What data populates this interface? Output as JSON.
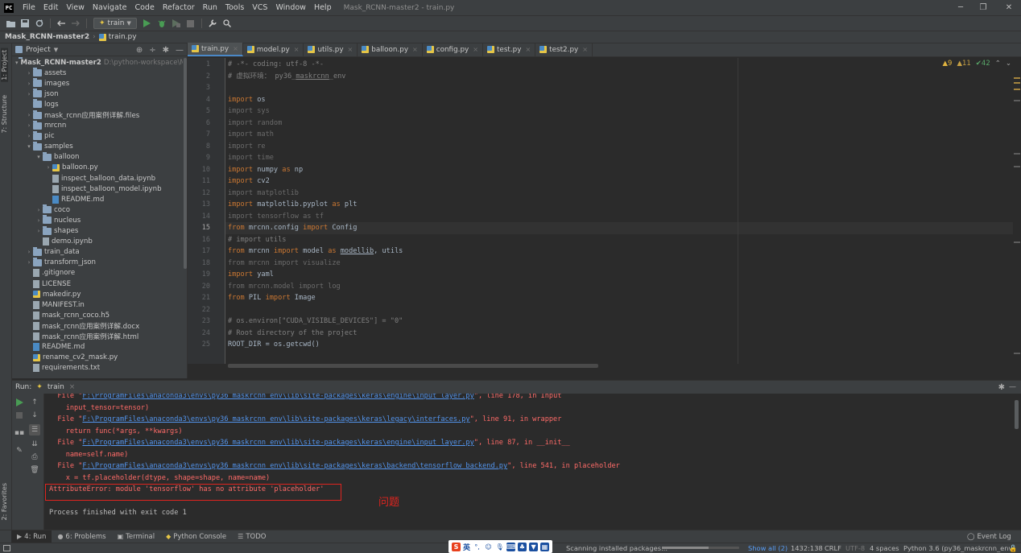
{
  "menubar": {
    "logo": "PC",
    "items": [
      "File",
      "Edit",
      "View",
      "Navigate",
      "Code",
      "Refactor",
      "Run",
      "Tools",
      "VCS",
      "Window",
      "Help"
    ],
    "window_title": "Mask_RCNN-master2 - train.py",
    "minimize": "─",
    "maximize": "❐",
    "close": "✕"
  },
  "toolbar": {
    "run_config": "train",
    "icons": [
      "open-folder-icon",
      "save-icon",
      "sync-icon",
      "back-icon",
      "forward-icon",
      "run-config-icon",
      "run-icon",
      "debug-icon",
      "coverage-icon",
      "stop-icon",
      "wrench-icon",
      "search-icon"
    ]
  },
  "navbar": {
    "project": "Mask_RCNN-master2",
    "file": "train.py"
  },
  "left_strip": {
    "project_label": "1: Project",
    "structure_label": "7: Structure",
    "favorites_label": "2: Favorites"
  },
  "project_panel": {
    "title": "Project",
    "tree": [
      {
        "label": "Mask_RCNN-master2",
        "path": "D:\\python-workspace\\Mas",
        "type": "folder",
        "depth": 0,
        "arrow": "▾",
        "bold": true
      },
      {
        "label": "assets",
        "type": "folder",
        "depth": 1,
        "arrow": "›"
      },
      {
        "label": "images",
        "type": "folder",
        "depth": 1,
        "arrow": "›"
      },
      {
        "label": "json",
        "type": "folder",
        "depth": 1,
        "arrow": "›"
      },
      {
        "label": "logs",
        "type": "folder",
        "depth": 1,
        "arrow": ""
      },
      {
        "label": "mask_rcnn应用案例详解.files",
        "type": "folder",
        "depth": 1,
        "arrow": "›"
      },
      {
        "label": "mrcnn",
        "type": "folder",
        "depth": 1,
        "arrow": "›"
      },
      {
        "label": "pic",
        "type": "folder",
        "depth": 1,
        "arrow": "›"
      },
      {
        "label": "samples",
        "type": "folder",
        "depth": 1,
        "arrow": "▾"
      },
      {
        "label": "balloon",
        "type": "folder",
        "depth": 2,
        "arrow": "▾"
      },
      {
        "label": "balloon.py",
        "type": "py",
        "depth": 3,
        "arrow": "›"
      },
      {
        "label": "inspect_balloon_data.ipynb",
        "type": "file",
        "depth": 3,
        "arrow": ""
      },
      {
        "label": "inspect_balloon_model.ipynb",
        "type": "file",
        "depth": 3,
        "arrow": ""
      },
      {
        "label": "README.md",
        "type": "md",
        "depth": 3,
        "arrow": ""
      },
      {
        "label": "coco",
        "type": "folder",
        "depth": 2,
        "arrow": "›"
      },
      {
        "label": "nucleus",
        "type": "folder",
        "depth": 2,
        "arrow": "›"
      },
      {
        "label": "shapes",
        "type": "folder",
        "depth": 2,
        "arrow": "›"
      },
      {
        "label": "demo.ipynb",
        "type": "file",
        "depth": 2,
        "arrow": ""
      },
      {
        "label": "train_data",
        "type": "folder",
        "depth": 1,
        "arrow": "›"
      },
      {
        "label": "transform_json",
        "type": "folder",
        "depth": 1,
        "arrow": "›"
      },
      {
        "label": ".gitignore",
        "type": "file",
        "depth": 1,
        "arrow": ""
      },
      {
        "label": "LICENSE",
        "type": "file",
        "depth": 1,
        "arrow": ""
      },
      {
        "label": "makedir.py",
        "type": "py",
        "depth": 1,
        "arrow": ""
      },
      {
        "label": "MANIFEST.in",
        "type": "file",
        "depth": 1,
        "arrow": ""
      },
      {
        "label": "mask_rcnn_coco.h5",
        "type": "file",
        "depth": 1,
        "arrow": ""
      },
      {
        "label": "mask_rcnn应用案例详解.docx",
        "type": "file",
        "depth": 1,
        "arrow": ""
      },
      {
        "label": "mask_rcnn应用案例详解.html",
        "type": "file",
        "depth": 1,
        "arrow": ""
      },
      {
        "label": "README.md",
        "type": "md",
        "depth": 1,
        "arrow": ""
      },
      {
        "label": "rename_cv2_mask.py",
        "type": "py",
        "depth": 1,
        "arrow": ""
      },
      {
        "label": "requirements.txt",
        "type": "file",
        "depth": 1,
        "arrow": ""
      }
    ]
  },
  "editor": {
    "tabs": [
      {
        "label": "train.py",
        "active": true
      },
      {
        "label": "model.py",
        "active": false
      },
      {
        "label": "utils.py",
        "active": false
      },
      {
        "label": "balloon.py",
        "active": false
      },
      {
        "label": "config.py",
        "active": false
      },
      {
        "label": "test.py",
        "active": false
      },
      {
        "label": "test2.py",
        "active": false
      }
    ],
    "tab_close": "×",
    "inspections": {
      "warnings": "▲9",
      "weak": "▲11",
      "ok": "✔42",
      "up": "⌃",
      "down": "⌄"
    },
    "current_line": 15,
    "lines": [
      {
        "n": 1,
        "parts": [
          [
            "cm",
            "# -*- coding: utf-8 -*-"
          ]
        ]
      },
      {
        "n": 2,
        "parts": [
          [
            "cm",
            "# 虚拟环境： py36_"
          ],
          [
            "cm ul",
            "maskrcnn"
          ],
          [
            "cm",
            "_env"
          ]
        ]
      },
      {
        "n": 3,
        "parts": []
      },
      {
        "n": 4,
        "parts": [
          [
            "kw",
            "import"
          ],
          [
            "cls",
            " os"
          ]
        ]
      },
      {
        "n": 5,
        "parts": [
          [
            "dim",
            "import sys"
          ]
        ]
      },
      {
        "n": 6,
        "parts": [
          [
            "dim",
            "import random"
          ]
        ]
      },
      {
        "n": 7,
        "parts": [
          [
            "dim",
            "import math"
          ]
        ]
      },
      {
        "n": 8,
        "parts": [
          [
            "dim",
            "import re"
          ]
        ]
      },
      {
        "n": 9,
        "parts": [
          [
            "dim",
            "import time"
          ]
        ]
      },
      {
        "n": 10,
        "parts": [
          [
            "kw",
            "import"
          ],
          [
            "cls",
            " numpy "
          ],
          [
            "kw",
            "as"
          ],
          [
            "cls",
            " np"
          ]
        ]
      },
      {
        "n": 11,
        "parts": [
          [
            "kw",
            "import"
          ],
          [
            "cls",
            " cv2"
          ]
        ]
      },
      {
        "n": 12,
        "parts": [
          [
            "dim",
            "import matplotlib"
          ]
        ]
      },
      {
        "n": 13,
        "parts": [
          [
            "kw",
            "import"
          ],
          [
            "cls",
            " matplotlib.pyplot "
          ],
          [
            "kw",
            "as"
          ],
          [
            "cls",
            " plt"
          ]
        ]
      },
      {
        "n": 14,
        "parts": [
          [
            "dim",
            "import tensorflow as tf"
          ]
        ]
      },
      {
        "n": 15,
        "parts": [
          [
            "kw",
            "from"
          ],
          [
            "cls",
            " mrcnn.config "
          ],
          [
            "kw",
            "import"
          ],
          [
            "cls",
            " Config"
          ]
        ]
      },
      {
        "n": 16,
        "parts": [
          [
            "cm",
            "# import utils"
          ]
        ]
      },
      {
        "n": 17,
        "parts": [
          [
            "kw",
            "from"
          ],
          [
            "cls",
            " mrcnn "
          ],
          [
            "kw",
            "import"
          ],
          [
            "cls",
            " model "
          ],
          [
            "kw",
            "as"
          ],
          [
            "cls",
            " "
          ],
          [
            "cls ul",
            "modellib"
          ],
          [
            "cls",
            ", utils"
          ]
        ]
      },
      {
        "n": 18,
        "parts": [
          [
            "dim",
            "from mrcnn import visualize"
          ]
        ]
      },
      {
        "n": 19,
        "parts": [
          [
            "kw",
            "import"
          ],
          [
            "cls",
            " yaml"
          ]
        ]
      },
      {
        "n": 20,
        "parts": [
          [
            "dim",
            "from mrcnn.model import log"
          ]
        ]
      },
      {
        "n": 21,
        "parts": [
          [
            "kw",
            "from"
          ],
          [
            "cls",
            " PIL "
          ],
          [
            "kw",
            "import"
          ],
          [
            "cls",
            " Image"
          ]
        ]
      },
      {
        "n": 22,
        "parts": []
      },
      {
        "n": 23,
        "parts": [
          [
            "cm",
            "# os.environ[\"CUDA_VISIBLE_DEVICES\"] = \"0\""
          ]
        ]
      },
      {
        "n": 24,
        "parts": [
          [
            "cm",
            "# Root directory of the project"
          ]
        ]
      },
      {
        "n": 25,
        "parts": [
          [
            "cls",
            "ROOT_DIR = os.getcwd()"
          ]
        ]
      }
    ]
  },
  "run_panel": {
    "label": "Run:",
    "config": "train",
    "close": "×",
    "output": [
      {
        "type": "link",
        "pre": "  File \"",
        "link": "F:\\ProgramFiles\\anaconda3\\envs\\py36_maskrcnn_env\\lib\\site-packages\\keras\\engine\\input_layer.py",
        "post": "\", line 178, in Input"
      },
      {
        "type": "text",
        "text": "    input_tensor=tensor)"
      },
      {
        "type": "link",
        "pre": "  File \"",
        "link": "F:\\ProgramFiles\\anaconda3\\envs\\py36_maskrcnn_env\\lib\\site-packages\\keras\\legacy\\interfaces.py",
        "post": "\", line 91, in wrapper"
      },
      {
        "type": "text",
        "text": "    return func(*args, **kwargs)"
      },
      {
        "type": "link",
        "pre": "  File \"",
        "link": "F:\\ProgramFiles\\anaconda3\\envs\\py36_maskrcnn_env\\lib\\site-packages\\keras\\engine\\input_layer.py",
        "post": "\", line 87, in __init__"
      },
      {
        "type": "text",
        "text": "    name=self.name)"
      },
      {
        "type": "link",
        "pre": "  File \"",
        "link": "F:\\ProgramFiles\\anaconda3\\envs\\py36_maskrcnn_env\\lib\\site-packages\\keras\\backend\\tensorflow_backend.py",
        "post": "\", line 541, in placeholder"
      },
      {
        "type": "text",
        "text": "    x = tf.placeholder(dtype, shape=shape, name=name)"
      },
      {
        "type": "text",
        "text": "AttributeError: module 'tensorflow' has no attribute 'placeholder'"
      },
      {
        "type": "blank",
        "text": ""
      },
      {
        "type": "plain",
        "text": "Process finished with exit code 1"
      }
    ],
    "annotation": "问题"
  },
  "bottom_tabs": [
    {
      "label": "4: Run",
      "icon": "▶",
      "active": true
    },
    {
      "label": "6: Problems",
      "icon": "●",
      "active": false
    },
    {
      "label": "Terminal",
      "icon": "▣",
      "active": false
    },
    {
      "label": "Python Console",
      "icon": "◆",
      "active": false
    },
    {
      "label": "TODO",
      "icon": "☰",
      "active": false
    }
  ],
  "event_log": "Event Log",
  "status": {
    "scanning": "Scanning installed packages...",
    "show_all": "Show all (2)",
    "position": "1432:138",
    "line_sep": "CRLF",
    "encoding": "UTF-8",
    "indent": "4 spaces",
    "interpreter": "Python 3.6 (py36_maskrcnn_env)",
    "ime_label": "英"
  },
  "colors": {
    "accent": "#4a88c7",
    "error": "#ff6b68",
    "annotation": "#e0241f",
    "link": "#5394ec",
    "keyword": "#cc7832"
  }
}
